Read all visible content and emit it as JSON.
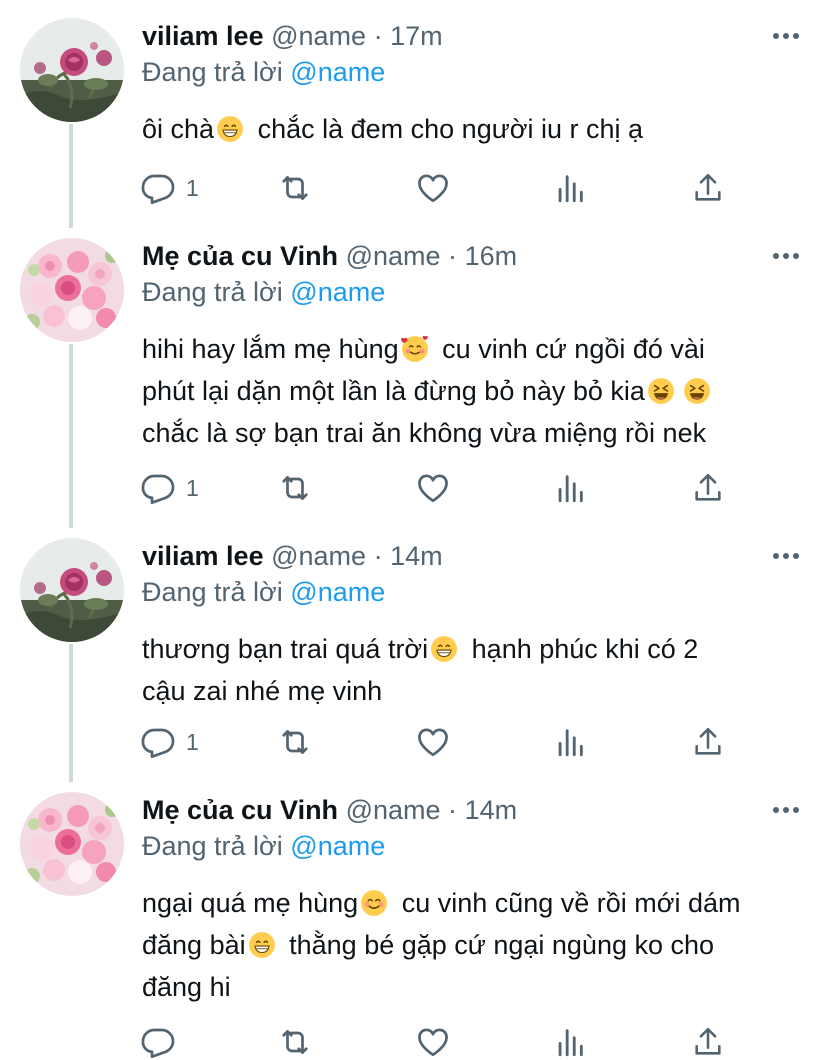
{
  "reply_prefix": "Đang trả lời",
  "tweets": [
    {
      "display_name": "viliam lee",
      "handle": "@name",
      "separator": "·",
      "time": "17m",
      "reply_to": "@name",
      "avatar": "rose-avatar",
      "lines": [
        "ôi chà",
        "chắc là đem cho người iu r chị ạ"
      ],
      "reply_count": "1"
    },
    {
      "display_name": "Mẹ của cu Vinh",
      "handle": "@name",
      "separator": "·",
      "time": "16m",
      "reply_to": "@name",
      "avatar": "bouquet-avatar",
      "lines": [
        "hihi hay lắm mẹ hùng",
        "cu vinh cứ ngồi đó vài",
        "phút lại dặn một lần là đừng bỏ này bỏ kia",
        "chắc là sợ bạn trai ăn không vừa miệng rồi nek"
      ],
      "reply_count": "1"
    },
    {
      "display_name": "viliam lee",
      "handle": "@name",
      "separator": "·",
      "time": "14m",
      "reply_to": "@name",
      "avatar": "rose-avatar",
      "lines": [
        "thương bạn trai quá trời",
        "hạnh phúc khi có 2",
        "cậu zai nhé mẹ vinh"
      ],
      "reply_count": "1"
    },
    {
      "display_name": "Mẹ của cu Vinh",
      "handle": "@name",
      "separator": "·",
      "time": "14m",
      "reply_to": "@name",
      "avatar": "bouquet-avatar",
      "lines": [
        "ngại quá mẹ hùng",
        "cu vinh cũng về rồi mới dám",
        "đăng bài",
        "thằng bé gặp cứ ngại ngùng ko cho",
        "đăng hi"
      ],
      "reply_count": ""
    }
  ],
  "icons": {
    "reply": "reply-icon",
    "retweet": "retweet-icon",
    "like": "heart-icon",
    "analytics": "analytics-icon",
    "share": "share-icon",
    "more": "more-icon"
  },
  "colors": {
    "text": "#0f1419",
    "secondary": "#536471",
    "mention": "#1d9bf0",
    "thread_line": "#cfd9de"
  }
}
